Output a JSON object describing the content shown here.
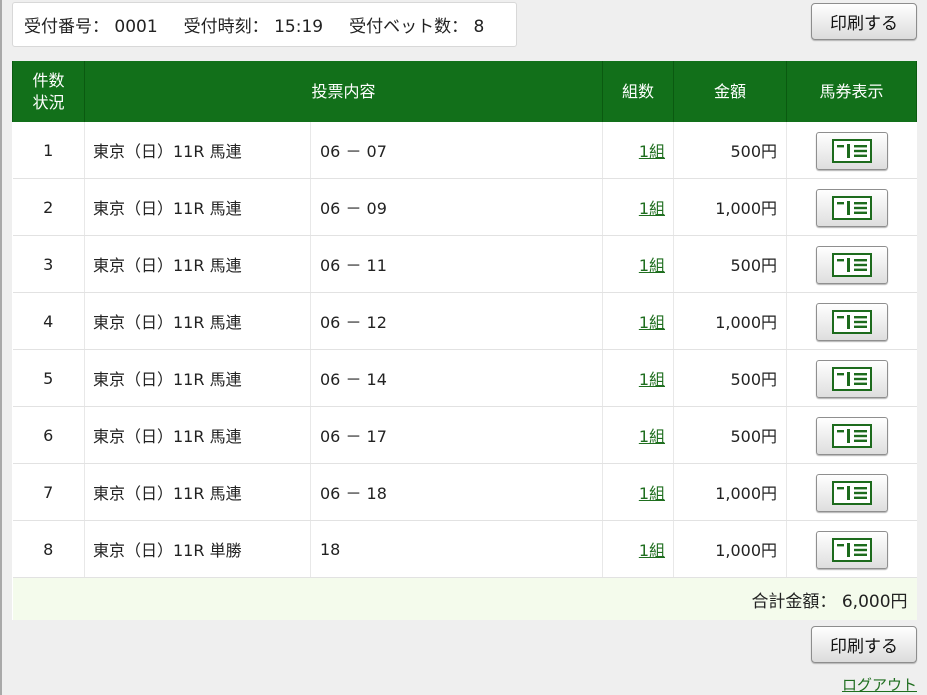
{
  "header": {
    "receipt_no_label": "受付番号：",
    "receipt_no": "0001",
    "receipt_time_label": "受付時刻：",
    "receipt_time": "15:19",
    "bet_count_label": "受付ベット数：",
    "bet_count": "8"
  },
  "buttons": {
    "print_label": "印刷する",
    "logout_label": "ログアウト"
  },
  "table": {
    "headers": {
      "count_line1": "件数",
      "count_line2": "状況",
      "content": "投票内容",
      "kumi": "組数",
      "amount": "金額",
      "ticket": "馬券表示"
    },
    "rows": [
      {
        "no": "1",
        "race": "東京（日）11R 馬連",
        "combo": "06 － 07",
        "kumi": "1組",
        "amount": "500円"
      },
      {
        "no": "2",
        "race": "東京（日）11R 馬連",
        "combo": "06 － 09",
        "kumi": "1組",
        "amount": "1,000円"
      },
      {
        "no": "3",
        "race": "東京（日）11R 馬連",
        "combo": "06 － 11",
        "kumi": "1組",
        "amount": "500円"
      },
      {
        "no": "4",
        "race": "東京（日）11R 馬連",
        "combo": "06 － 12",
        "kumi": "1組",
        "amount": "1,000円"
      },
      {
        "no": "5",
        "race": "東京（日）11R 馬連",
        "combo": "06 － 14",
        "kumi": "1組",
        "amount": "500円"
      },
      {
        "no": "6",
        "race": "東京（日）11R 馬連",
        "combo": "06 － 17",
        "kumi": "1組",
        "amount": "500円"
      },
      {
        "no": "7",
        "race": "東京（日）11R 馬連",
        "combo": "06 － 18",
        "kumi": "1組",
        "amount": "1,000円"
      },
      {
        "no": "8",
        "race": "東京（日）11R 単勝",
        "combo": "18",
        "kumi": "1組",
        "amount": "1,000円"
      }
    ],
    "total_label": "合計金額：",
    "total_value": "6,000円"
  },
  "icons": {
    "ticket": "ticket-icon"
  },
  "colors": {
    "header_green": "#12701a",
    "link_green": "#1f6e1f",
    "total_bg": "#f4fbec"
  }
}
